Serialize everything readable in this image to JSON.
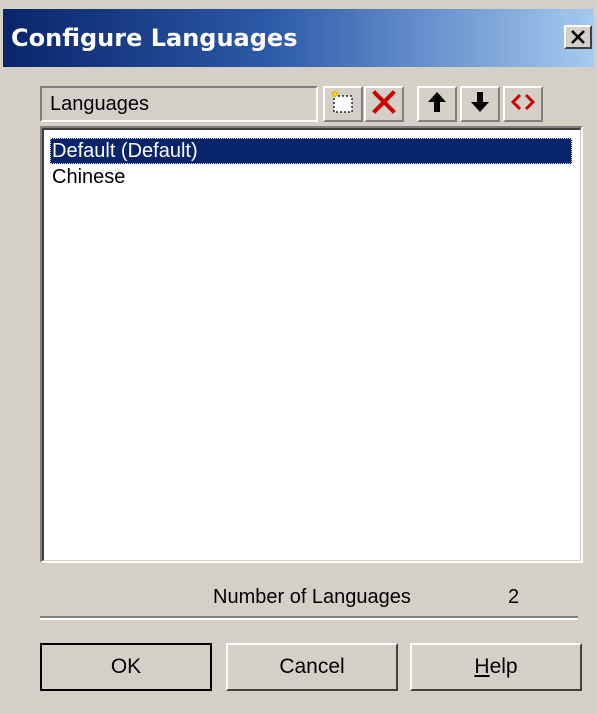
{
  "window": {
    "title": "Configure Languages",
    "close_glyph": "✕"
  },
  "list": {
    "header_label": "Languages",
    "toolbar": [
      {
        "name": "new-language-button",
        "icon": "new-item-icon",
        "tooltip": ""
      },
      {
        "name": "delete-language-button",
        "icon": "delete-x-icon",
        "tooltip": ""
      },
      {
        "name": "move-up-button",
        "icon": "arrow-up-icon",
        "tooltip": ""
      },
      {
        "name": "move-down-button",
        "icon": "arrow-down-icon",
        "tooltip": ""
      },
      {
        "name": "edit-language-button",
        "icon": "angle-brackets-icon",
        "tooltip": ""
      }
    ],
    "items": [
      {
        "label": "Default (Default)",
        "selected": true
      },
      {
        "label": "Chinese",
        "selected": false
      }
    ]
  },
  "summary": {
    "count_label": "Number of Languages",
    "count_value": "2"
  },
  "buttons": {
    "ok_label": "OK",
    "cancel_label": "Cancel",
    "help_label": "Help",
    "help_mnemonic": "H",
    "help_rest": "elp"
  },
  "colors": {
    "title_start": "#0a246a",
    "title_end": "#a6caf0",
    "selection": "#0a246a",
    "face": "#d4d0c8",
    "delete_red": "#cc0000",
    "edit_red": "#cc0000"
  }
}
